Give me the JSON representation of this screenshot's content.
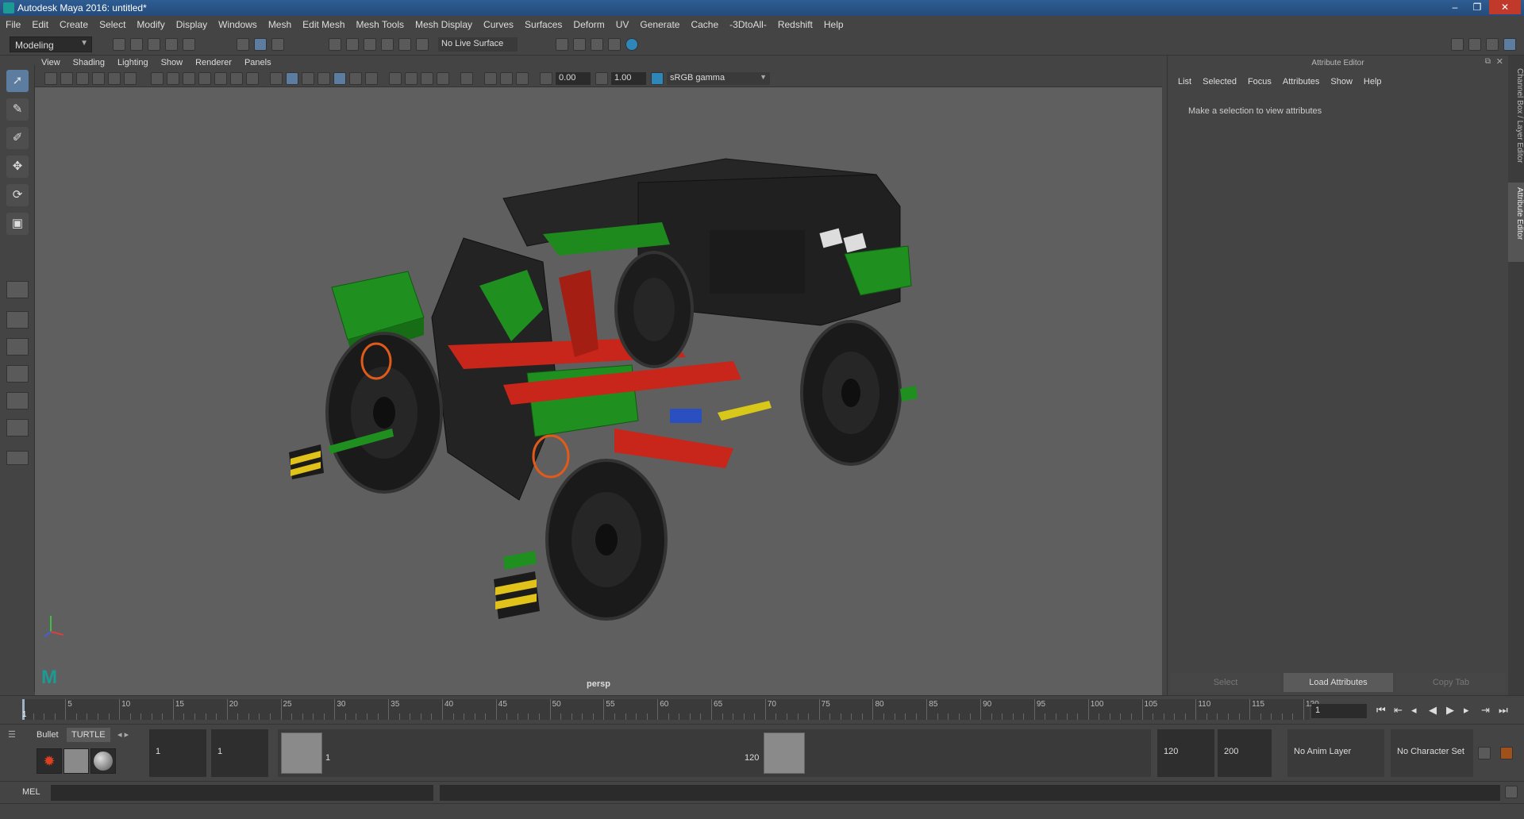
{
  "window": {
    "title": "Autodesk Maya 2016: untitled*"
  },
  "menubar": [
    "File",
    "Edit",
    "Create",
    "Select",
    "Modify",
    "Display",
    "Windows",
    "Mesh",
    "Edit Mesh",
    "Mesh Tools",
    "Mesh Display",
    "Curves",
    "Surfaces",
    "Deform",
    "UV",
    "Generate",
    "Cache",
    "-3DtoAll-",
    "Redshift",
    "Help"
  ],
  "shelf": {
    "mode": "Modeling",
    "live_surface": "No Live Surface"
  },
  "panel": {
    "menu": [
      "View",
      "Shading",
      "Lighting",
      "Show",
      "Renderer",
      "Panels"
    ],
    "exposure": "0.00",
    "gamma": "1.00",
    "colorspace": "sRGB gamma",
    "camera_label": "persp"
  },
  "attribute_editor": {
    "title": "Attribute Editor",
    "menu": [
      "List",
      "Selected",
      "Focus",
      "Attributes",
      "Show",
      "Help"
    ],
    "message": "Make a selection to view attributes",
    "buttons": {
      "select": "Select",
      "load": "Load Attributes",
      "copy": "Copy Tab"
    }
  },
  "side_tabs": {
    "channel": "Channel Box / Layer Editor",
    "attr": "Attribute Editor"
  },
  "timeline": {
    "ticks": [
      "5",
      "10",
      "15",
      "20",
      "25",
      "30",
      "35",
      "40",
      "45",
      "50",
      "55",
      "60",
      "65",
      "70",
      "75",
      "80",
      "85",
      "90",
      "95",
      "100",
      "105",
      "110",
      "115",
      "120"
    ],
    "start_label": "1",
    "current_frame": "1"
  },
  "range": {
    "tabs": {
      "bullet": "Bullet",
      "turtle": "TURTLE"
    },
    "start_a": "1",
    "start_b": "1",
    "handle_start": "1",
    "handle_end": "120",
    "end_a": "120",
    "end_b": "200",
    "anim_layer": "No Anim Layer",
    "character_set": "No Character Set"
  },
  "command": {
    "label": "MEL"
  },
  "colors": {
    "tractor_green": "#1f8f1f",
    "tractor_red": "#c8261a",
    "tractor_body": "#222222",
    "accent": "#5d7da0"
  }
}
